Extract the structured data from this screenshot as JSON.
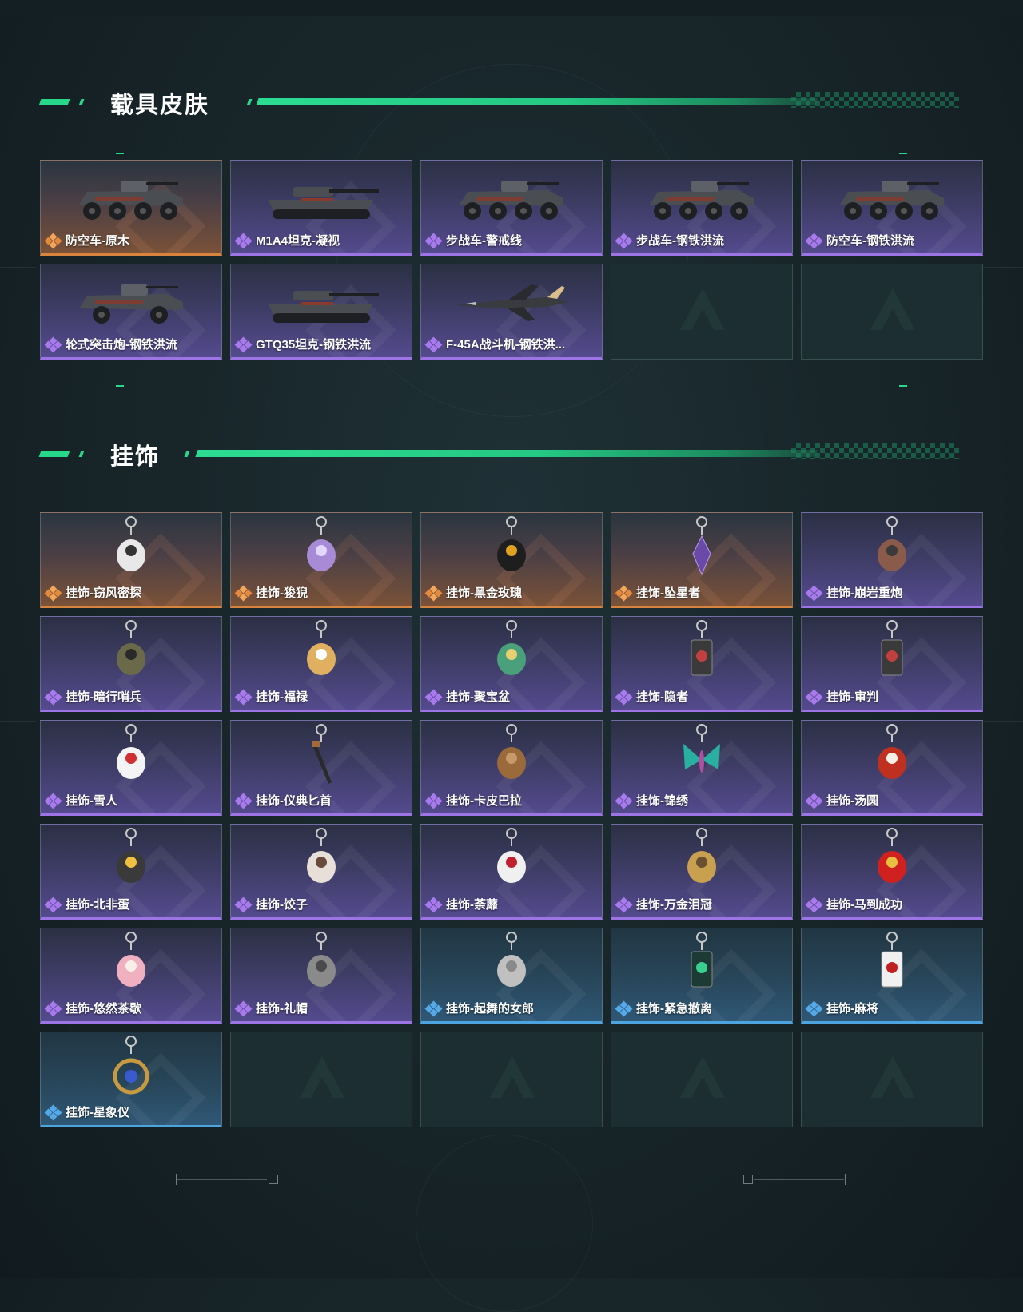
{
  "sections": {
    "vehicle_skins": {
      "title": "载具皮肤",
      "items": [
        {
          "label": "防空车-原木",
          "rarity": "gold",
          "icon": "armored-car-icon"
        },
        {
          "label": "M1A4坦克-凝视",
          "rarity": "purple",
          "icon": "tank-icon"
        },
        {
          "label": "步战车-警戒线",
          "rarity": "purple",
          "icon": "ifv-icon"
        },
        {
          "label": "步战车-钢铁洪流",
          "rarity": "purple",
          "icon": "ifv-icon"
        },
        {
          "label": "防空车-钢铁洪流",
          "rarity": "purple",
          "icon": "armored-car-icon"
        },
        {
          "label": "轮式突击炮-钢铁洪流",
          "rarity": "purple",
          "icon": "assault-gun-icon"
        },
        {
          "label": "GTQ35坦克-钢铁洪流",
          "rarity": "purple",
          "icon": "tank-icon"
        },
        {
          "label": "F-45A战斗机-钢铁洪...",
          "rarity": "purple",
          "icon": "fighter-jet-icon"
        }
      ],
      "empty_slots": 2
    },
    "charms": {
      "title": "挂饰",
      "items": [
        {
          "label": "挂饰-窃风密探",
          "rarity": "gold",
          "icon": "rabbit-charm-icon"
        },
        {
          "label": "挂饰-狻猊",
          "rarity": "gold",
          "icon": "lion-charm-icon"
        },
        {
          "label": "挂饰-黑金玫瑰",
          "rarity": "gold",
          "icon": "rose-charm-icon"
        },
        {
          "label": "挂饰-坠星者",
          "rarity": "gold",
          "icon": "crystal-charm-icon"
        },
        {
          "label": "挂饰-崩岩重炮",
          "rarity": "purple",
          "icon": "soldier-charm-icon"
        },
        {
          "label": "挂饰-暗行哨兵",
          "rarity": "purple",
          "icon": "sentinel-charm-icon"
        },
        {
          "label": "挂饰-福禄",
          "rarity": "purple",
          "icon": "gourd-charm-icon"
        },
        {
          "label": "挂饰-聚宝盆",
          "rarity": "purple",
          "icon": "treasure-bowl-charm-icon"
        },
        {
          "label": "挂饰-隐者",
          "rarity": "purple",
          "icon": "tarot-card-charm-icon"
        },
        {
          "label": "挂饰-审判",
          "rarity": "purple",
          "icon": "tarot-card-charm-icon"
        },
        {
          "label": "挂饰-雪人",
          "rarity": "purple",
          "icon": "snowman-charm-icon"
        },
        {
          "label": "挂饰-仪典匕首",
          "rarity": "purple",
          "icon": "dagger-charm-icon"
        },
        {
          "label": "挂饰-卡皮巴拉",
          "rarity": "purple",
          "icon": "capybara-charm-icon"
        },
        {
          "label": "挂饰-锦绣",
          "rarity": "purple",
          "icon": "butterfly-charm-icon"
        },
        {
          "label": "挂饰-汤圆",
          "rarity": "purple",
          "icon": "dumpling-bowl-charm-icon"
        },
        {
          "label": "挂饰-北非蛋",
          "rarity": "purple",
          "icon": "egg-pan-charm-icon"
        },
        {
          "label": "挂饰-饺子",
          "rarity": "purple",
          "icon": "dumplings-charm-icon"
        },
        {
          "label": "挂饰-荼蘼",
          "rarity": "purple",
          "icon": "flower-charm-icon"
        },
        {
          "label": "挂饰-万金泪冠",
          "rarity": "purple",
          "icon": "crown-charm-icon"
        },
        {
          "label": "挂饰-马到成功",
          "rarity": "purple",
          "icon": "horse-charm-icon"
        },
        {
          "label": "挂饰-悠然茶歇",
          "rarity": "purple",
          "icon": "cupcake-charm-icon"
        },
        {
          "label": "挂饰-礼帽",
          "rarity": "purple",
          "icon": "hat-charm-icon"
        },
        {
          "label": "挂饰-起舞的女郎",
          "rarity": "blue",
          "icon": "dancer-charm-icon"
        },
        {
          "label": "挂饰-紧急撤离",
          "rarity": "blue",
          "icon": "exit-sign-charm-icon"
        },
        {
          "label": "挂饰-麻将",
          "rarity": "blue",
          "icon": "mahjong-tile-charm-icon"
        },
        {
          "label": "挂饰-星象仪",
          "rarity": "blue",
          "icon": "astrolabe-charm-icon"
        }
      ],
      "empty_slots": 4
    }
  },
  "colors": {
    "accent_green": "#27d88a",
    "rarity_gold": "#d9843e",
    "rarity_purple": "#9d74e6",
    "rarity_blue": "#4ea4e0",
    "background": "#172428"
  }
}
